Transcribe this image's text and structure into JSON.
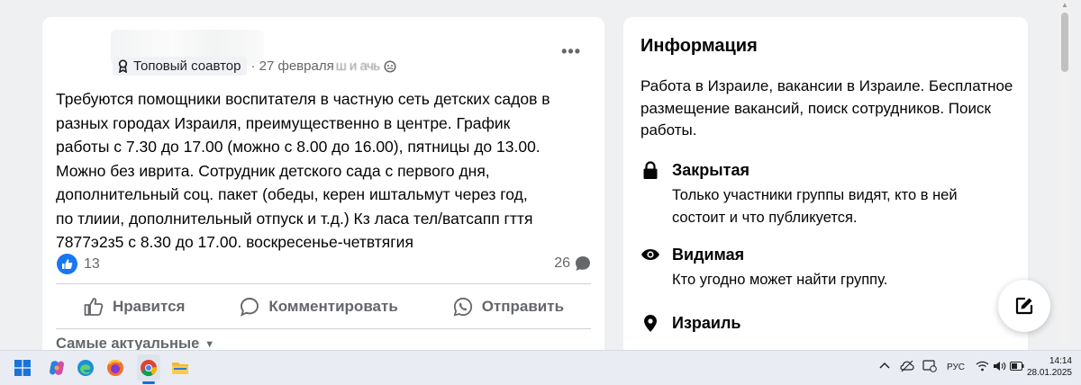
{
  "post": {
    "badge_label": "Топовый соавтор",
    "date": "· 27 февраля",
    "date_blur": "ш и ачь",
    "lines": [
      "Требуются помощники воспитателя в частную сеть детских садов в",
      "разных городах Израиля, преимущественно в центре. График",
      "работы с 7.30 до 17.00 (можно с 8.00 до 16.00), пятницы до 13.00.",
      "Можно без иврита. Сотрудник детского сада с первого дня,",
      "дополнительный соц. пакет (обеды, керен иштальмут через год,",
      "по тлиии, дополнительный отпуск и т.д.) Кз ласа тел/ватсапп гття",
      "7877э2з5 с 8.30 до 17.00. воскресенье-четвтягия"
    ],
    "likes_count": "13",
    "comments_count": "26",
    "actions": {
      "like": "Нравится",
      "comment": "Комментировать",
      "share": "Отправить"
    },
    "sort_label": "Самые актуальные"
  },
  "info": {
    "title": "Информация",
    "description": "Работа в Израиле, вакансии в Израиле. Бесплатное размещение вакансий, поиск сотрудников. Поиск работы.",
    "items": [
      {
        "icon": "lock-icon",
        "title": "Закрытая",
        "desc": "Только участники группы видят, кто в ней состоит и что публикуется."
      },
      {
        "icon": "eye-icon",
        "title": "Видимая",
        "desc": "Кто угодно может найти группу."
      },
      {
        "icon": "location-pin-icon",
        "title": "Израиль",
        "desc": ""
      }
    ]
  },
  "taskbar": {
    "language": "РУС",
    "time": "14:14",
    "date": "28.01.2025"
  },
  "colors": {
    "facebook_blue": "#1877f2",
    "secondary_text": "#65676b",
    "page_background": "#eef0f2"
  }
}
